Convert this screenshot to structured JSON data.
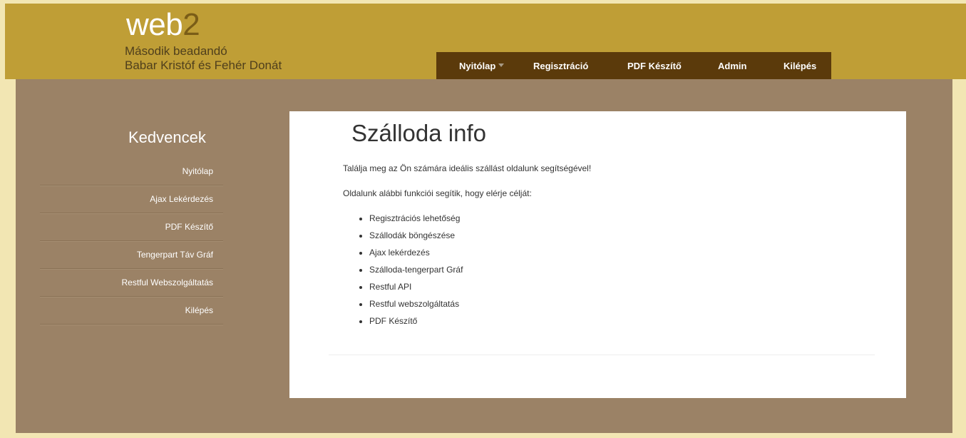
{
  "header": {
    "logo_text": "web",
    "logo_num": "2",
    "subtitle_line1": "Második beadandó",
    "subtitle_line2": "Babar Kristóf és Fehér Donát"
  },
  "nav": {
    "items": [
      {
        "label": "Nyitólap",
        "has_dropdown": true
      },
      {
        "label": "Regisztráció"
      },
      {
        "label": "PDF Készítő"
      },
      {
        "label": "Admin"
      },
      {
        "label": "Kilépés"
      }
    ]
  },
  "sidebar": {
    "title": "Kedvencek",
    "items": [
      {
        "label": "Nyitólap"
      },
      {
        "label": "Ajax Lekérdezés"
      },
      {
        "label": "PDF Készítő"
      },
      {
        "label": "Tengerpart Táv Gráf"
      },
      {
        "label": "Restful Webszolgáltatás"
      },
      {
        "label": "Kilépés"
      }
    ]
  },
  "content": {
    "title": "Szálloda info",
    "intro": "Találja meg az Ön számára ideális szállást oldalunk segítségével!",
    "features_intro": "Oldalunk alábbi funkciói segítik, hogy elérje célját:",
    "features": [
      "Regisztrációs lehetőség",
      "Szállodák böngészése",
      "Ajax lekérdezés",
      "Szálloda-tengerpart Gráf",
      "Restful API",
      "Restful webszolgáltatás",
      "PDF Készítő"
    ]
  },
  "colors": {
    "header_bg": "#bf9e36",
    "nav_bg": "#5b3a0b",
    "main_bg": "#9b8266",
    "page_bg": "#f2e6b3"
  }
}
